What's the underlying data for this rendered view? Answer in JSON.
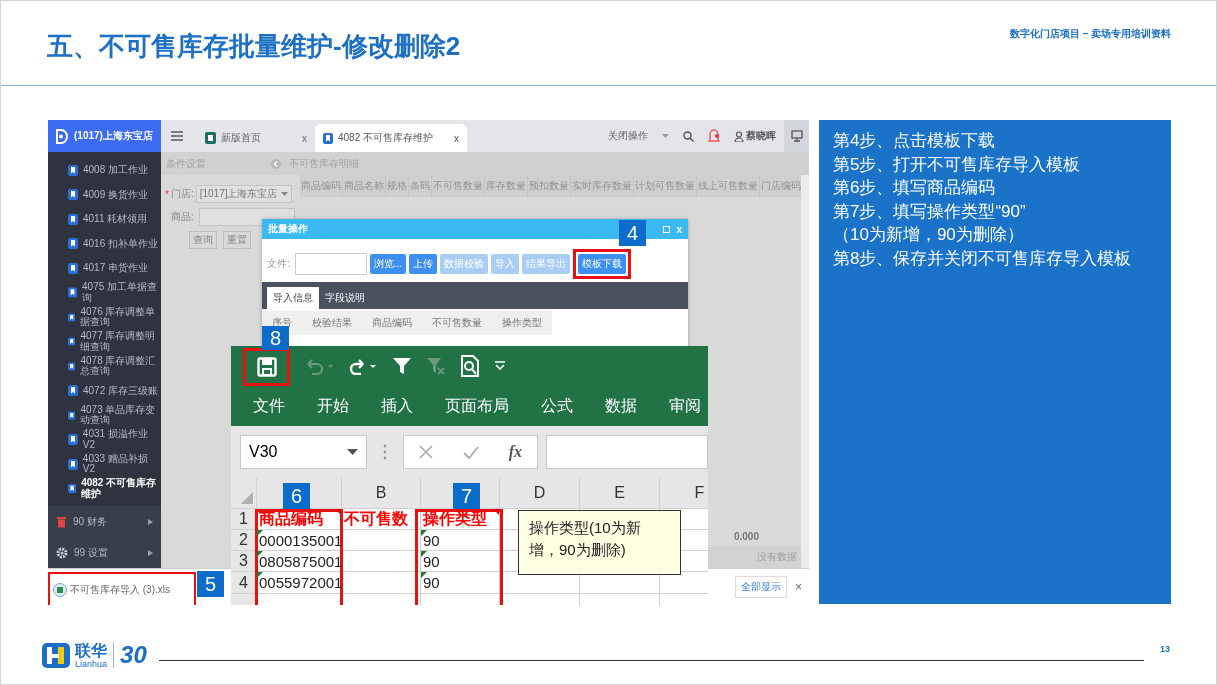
{
  "slide": {
    "title": "五、不可售库存批量维护-修改删除2",
    "subtitle": "数字化门店项目 – 卖场专用培训资料"
  },
  "app": {
    "store": "(1017)上海东宝店",
    "menu_items": [
      {
        "label": "4008 加工作业",
        "selected": false
      },
      {
        "label": "4009 换货作业",
        "selected": false
      },
      {
        "label": "4011 耗材领用",
        "selected": false
      },
      {
        "label": "4016 扣补单作业",
        "selected": false
      },
      {
        "label": "4017 串货作业",
        "selected": false
      },
      {
        "label": "4075 加工单据查询",
        "selected": false
      },
      {
        "label": "4076 库存调整单据查询",
        "selected": false
      },
      {
        "label": "4077 库存调整明细查询",
        "selected": false
      },
      {
        "label": "4078 库存调整汇总查询",
        "selected": false
      },
      {
        "label": "4072 库存三级账",
        "selected": false
      },
      {
        "label": "4073 单品库存变动查询",
        "selected": false
      },
      {
        "label": "4031 损溢作业V2",
        "selected": false
      },
      {
        "label": "4033 赠品补损V2",
        "selected": false
      },
      {
        "label": "4082 不可售库存维护",
        "selected": true
      }
    ],
    "menu_groups": [
      {
        "label": "90 财务",
        "kind": "finance"
      },
      {
        "label": "99 设置",
        "kind": "settings"
      }
    ],
    "tabs": [
      {
        "label": "新版首页",
        "close": "x",
        "selected": false
      },
      {
        "label": "4082 不可售库存维护",
        "close": "x",
        "selected": true
      }
    ],
    "close_menu": "关闭操作",
    "user": "蔡晓晖",
    "panel_titles": [
      "条件设置",
      "不可售库存明细"
    ],
    "filter": {
      "required_mark": "*",
      "store_label": "门店:",
      "store_value": "[1017]上海东宝店",
      "product_label": "商品:",
      "buttons": [
        "查询",
        "重置"
      ]
    },
    "table": {
      "columns": [
        "商品编码",
        "商品名称",
        "规格",
        "条码",
        "不可售数量",
        "库存数量",
        "预扣数量",
        "实时库存数量",
        "计划可售数量",
        "线上可售数量",
        "门店编码"
      ],
      "total": "0.000",
      "empty_text": "没有数据"
    },
    "dialog": {
      "title": "批量操作",
      "close": "x",
      "file_label": "文件:",
      "buttons": [
        {
          "label": "浏览...",
          "disabled": false
        },
        {
          "label": "上传",
          "disabled": false
        },
        {
          "label": "数据校验",
          "disabled": true
        },
        {
          "label": "导入",
          "disabled": true
        },
        {
          "label": "结果导出",
          "disabled": true
        },
        {
          "label": "模板下载",
          "disabled": false
        }
      ],
      "tabs": [
        {
          "label": "导入信息",
          "selected": true
        },
        {
          "label": "字段说明",
          "selected": false
        }
      ],
      "columns": [
        "序号",
        "校验结果",
        "商品编码",
        "不可售数量",
        "操作类型"
      ]
    },
    "download": {
      "file": "不可售库存导入 (3).xls",
      "show_all": "全部显示",
      "close": "×"
    }
  },
  "excel": {
    "ribbon_tabs": [
      "文件",
      "开始",
      "插入",
      "页面布局",
      "公式",
      "数据",
      "审阅"
    ],
    "name_box": "V30",
    "function_label": "fx",
    "column_letters": [
      "B",
      "D",
      "E",
      "F"
    ],
    "header_row": {
      "num": "1",
      "cells": [
        "商品编码",
        "不可售数",
        "操作类型"
      ]
    },
    "rows": [
      {
        "num": "2",
        "code": "0000135001",
        "type": "90"
      },
      {
        "num": "3",
        "code": "0805875001",
        "type": "90"
      },
      {
        "num": "4",
        "code": "0055972001",
        "type": "90"
      }
    ]
  },
  "note": "操作类型(10为新增，90为删除)",
  "callouts": {
    "template_download": "4",
    "download_file": "5",
    "product_code_column": "6",
    "operation_type_column": "7",
    "save": "8"
  },
  "steps": [
    "第4步、点击模板下载",
    "第5步、打开不可售库存导入模板",
    "第6步、填写商品编码",
    "第7步、填写操作类型“90”",
    "（10为新增，90为删除）",
    "第8步、保存并关闭不可售库存导入模板"
  ],
  "footer": {
    "brand": "联华",
    "brand_en": "Lianhua",
    "anniversary": "30",
    "page": "13"
  }
}
